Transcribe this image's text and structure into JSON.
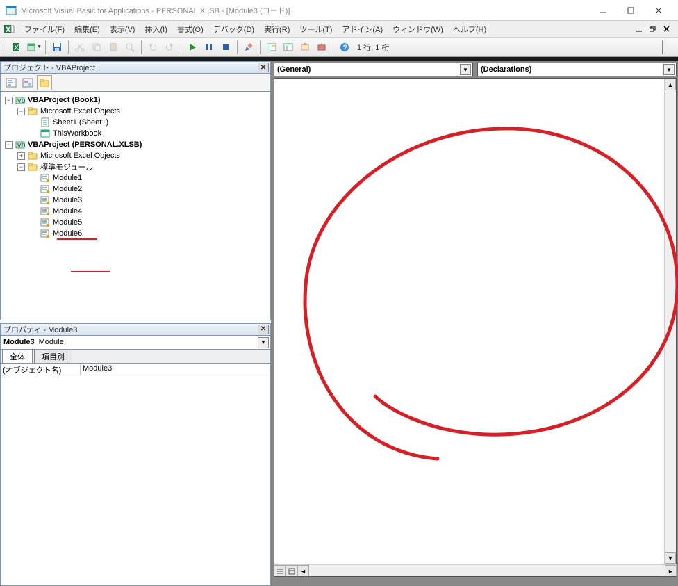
{
  "titlebar": {
    "text": "Microsoft Visual Basic for Applications - PERSONAL.XLSB - [Module3 (コード)]"
  },
  "menubar": {
    "items": [
      {
        "label": "ファイル(F)",
        "u": "F"
      },
      {
        "label": "編集(E)",
        "u": "E"
      },
      {
        "label": "表示(V)",
        "u": "V"
      },
      {
        "label": "挿入(I)",
        "u": "I"
      },
      {
        "label": "書式(O)",
        "u": "O"
      },
      {
        "label": "デバッグ(D)",
        "u": "D"
      },
      {
        "label": "実行(R)",
        "u": "R"
      },
      {
        "label": "ツール(T)",
        "u": "T"
      },
      {
        "label": "アドイン(A)",
        "u": "A"
      },
      {
        "label": "ウィンドウ(W)",
        "u": "W"
      },
      {
        "label": "ヘルプ(H)",
        "u": "H"
      }
    ]
  },
  "toolbar": {
    "status": "1 行, 1 桁"
  },
  "project_pane": {
    "title": "プロジェクト - VBAProject",
    "tree": [
      {
        "depth": 0,
        "pm": "-",
        "icon": "vba",
        "label": "VBAProject (Book1)",
        "bold": true
      },
      {
        "depth": 1,
        "pm": "-",
        "icon": "folder",
        "label": "Microsoft Excel Objects",
        "bold": false
      },
      {
        "depth": 2,
        "pm": "",
        "icon": "sheet",
        "label": "Sheet1 (Sheet1)",
        "bold": false
      },
      {
        "depth": 2,
        "pm": "",
        "icon": "workbook",
        "label": "ThisWorkbook",
        "bold": false
      },
      {
        "depth": 0,
        "pm": "-",
        "icon": "vba",
        "label": "VBAProject (PERSONAL.XLSB)",
        "bold": true
      },
      {
        "depth": 1,
        "pm": "+",
        "icon": "folder",
        "label": "Microsoft Excel Objects",
        "bold": false
      },
      {
        "depth": 1,
        "pm": "-",
        "icon": "folder",
        "label": "標準モジュール",
        "bold": false
      },
      {
        "depth": 2,
        "pm": "",
        "icon": "module",
        "label": "Module1",
        "bold": false
      },
      {
        "depth": 2,
        "pm": "",
        "icon": "module",
        "label": "Module2",
        "bold": false
      },
      {
        "depth": 2,
        "pm": "",
        "icon": "module",
        "label": "Module3",
        "bold": false
      },
      {
        "depth": 2,
        "pm": "",
        "icon": "module",
        "label": "Module4",
        "bold": false
      },
      {
        "depth": 2,
        "pm": "",
        "icon": "module",
        "label": "Module5",
        "bold": false
      },
      {
        "depth": 2,
        "pm": "",
        "icon": "module",
        "label": "Module6",
        "bold": false
      }
    ]
  },
  "properties_pane": {
    "title": "プロパティ - Module3",
    "object_name": "Module3",
    "object_type": "Module",
    "tabs": {
      "all": "全体",
      "bycat": "項目別"
    },
    "rows": [
      {
        "key": "(オブジェクト名)",
        "val": "Module3"
      }
    ]
  },
  "code_pane": {
    "left_dd": "(General)",
    "right_dd": "(Declarations)"
  }
}
